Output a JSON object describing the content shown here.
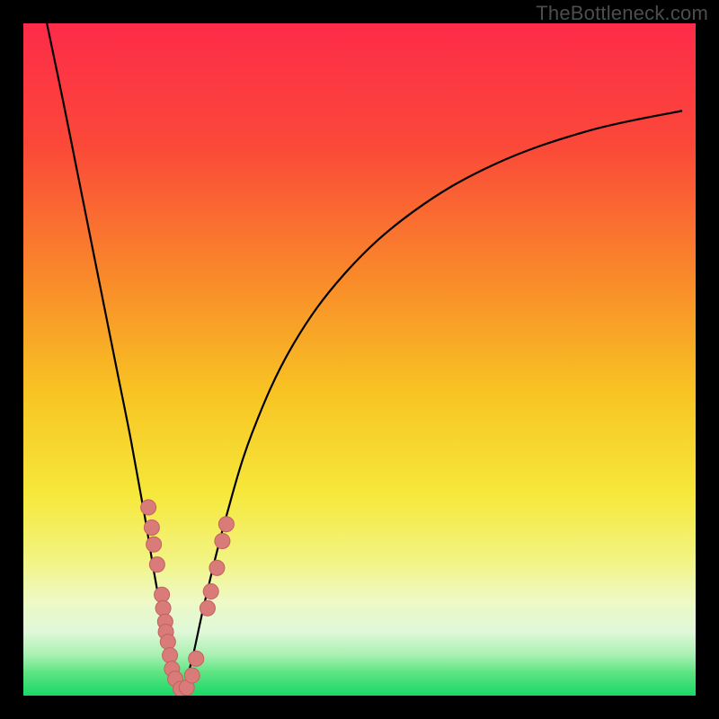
{
  "watermark": "TheBottleneck.com",
  "colors": {
    "frame": "#000000",
    "curve_stroke": "#000000",
    "marker_fill": "#d97b79",
    "marker_stroke": "#c46160",
    "gradient_stops": [
      {
        "offset": 0.0,
        "color": "#fd2b49"
      },
      {
        "offset": 0.18,
        "color": "#fb4839"
      },
      {
        "offset": 0.38,
        "color": "#f98a2a"
      },
      {
        "offset": 0.55,
        "color": "#f8c423"
      },
      {
        "offset": 0.7,
        "color": "#f6e83a"
      },
      {
        "offset": 0.8,
        "color": "#f2f484"
      },
      {
        "offset": 0.86,
        "color": "#eef9c6"
      },
      {
        "offset": 0.905,
        "color": "#dff8d8"
      },
      {
        "offset": 0.94,
        "color": "#a7f0b1"
      },
      {
        "offset": 0.965,
        "color": "#5fe583"
      },
      {
        "offset": 1.0,
        "color": "#19d866"
      }
    ]
  },
  "chart_data": {
    "type": "line",
    "title": "",
    "xlabel": "",
    "ylabel": "",
    "xlim": [
      0,
      100
    ],
    "ylim": [
      0,
      100
    ],
    "note": "V-shaped bottleneck curve; y is mismatch % (high=red=bad, low=green=good). Axis values estimated from position within 0–100.",
    "series": [
      {
        "name": "left-branch",
        "x": [
          3.5,
          6,
          8,
          10,
          12,
          14,
          16,
          18,
          19.5,
          21,
          22.5,
          23.5
        ],
        "y": [
          100,
          88,
          78,
          68,
          58,
          48,
          38,
          27,
          18,
          10,
          4,
          0.5
        ]
      },
      {
        "name": "right-branch",
        "x": [
          23.5,
          25,
          27,
          30,
          34,
          40,
          48,
          58,
          70,
          84,
          98
        ],
        "y": [
          0.5,
          5,
          14,
          26,
          39,
          52,
          63,
          72,
          79,
          84,
          87
        ]
      }
    ],
    "markers": {
      "name": "highlighted-points",
      "points": [
        {
          "x": 18.6,
          "y": 28
        },
        {
          "x": 19.1,
          "y": 25
        },
        {
          "x": 19.4,
          "y": 22.5
        },
        {
          "x": 19.9,
          "y": 19.5
        },
        {
          "x": 20.6,
          "y": 15
        },
        {
          "x": 20.8,
          "y": 13
        },
        {
          "x": 21.1,
          "y": 11
        },
        {
          "x": 21.2,
          "y": 9.5
        },
        {
          "x": 21.5,
          "y": 8
        },
        {
          "x": 21.8,
          "y": 6
        },
        {
          "x": 22.1,
          "y": 4
        },
        {
          "x": 22.6,
          "y": 2.5
        },
        {
          "x": 23.4,
          "y": 1
        },
        {
          "x": 24.3,
          "y": 1.2
        },
        {
          "x": 25.1,
          "y": 3
        },
        {
          "x": 25.7,
          "y": 5.5
        },
        {
          "x": 27.4,
          "y": 13
        },
        {
          "x": 27.9,
          "y": 15.5
        },
        {
          "x": 28.8,
          "y": 19
        },
        {
          "x": 29.6,
          "y": 23
        },
        {
          "x": 30.2,
          "y": 25.5
        }
      ]
    }
  }
}
